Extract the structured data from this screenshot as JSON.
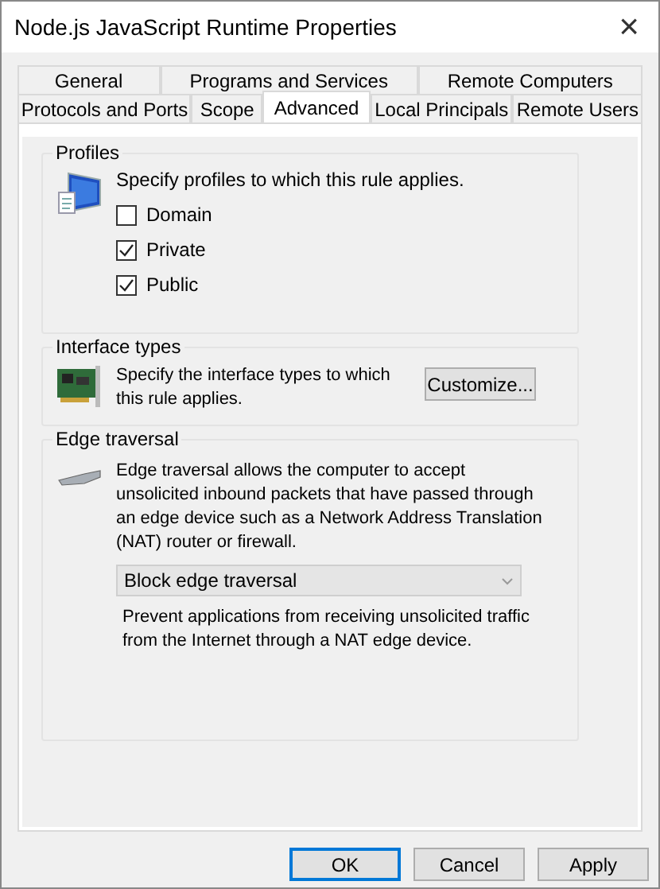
{
  "window": {
    "title": "Node.js JavaScript Runtime Properties",
    "close": "×"
  },
  "tab_rows": [
    [
      {
        "label": "General",
        "selected": false
      },
      {
        "label": "Programs and Services",
        "selected": false
      },
      {
        "label": "Remote Computers",
        "selected": false
      }
    ],
    [
      {
        "label": "Protocols and Ports",
        "selected": false
      },
      {
        "label": "Scope",
        "selected": false
      },
      {
        "label": "Advanced",
        "selected": true
      },
      {
        "label": "Local Principals",
        "selected": false
      },
      {
        "label": "Remote Users",
        "selected": false
      }
    ]
  ],
  "profiles": {
    "title": "Profiles",
    "description": "Specify profiles to which this rule applies.",
    "options": [
      {
        "label": "Domain",
        "checked": false
      },
      {
        "label": "Private",
        "checked": true
      },
      {
        "label": "Public",
        "checked": true
      }
    ]
  },
  "interface_types": {
    "title": "Interface types",
    "description": "Specify the interface types to which this rule applies.",
    "button": "Customize..."
  },
  "edge_traversal": {
    "title": "Edge traversal",
    "description": "Edge traversal allows the computer to accept unsolicited inbound packets that have passed through an edge device such as a Network Address Translation (NAT) router or firewall.",
    "dropdown": {
      "value": "Block edge traversal"
    },
    "note": "Prevent applications from receiving unsolicited traffic from the Internet through a NAT edge device."
  },
  "buttons": [
    {
      "label": "OK",
      "default": true
    },
    {
      "label": "Cancel",
      "default": false
    },
    {
      "label": "Apply",
      "default": false
    }
  ]
}
